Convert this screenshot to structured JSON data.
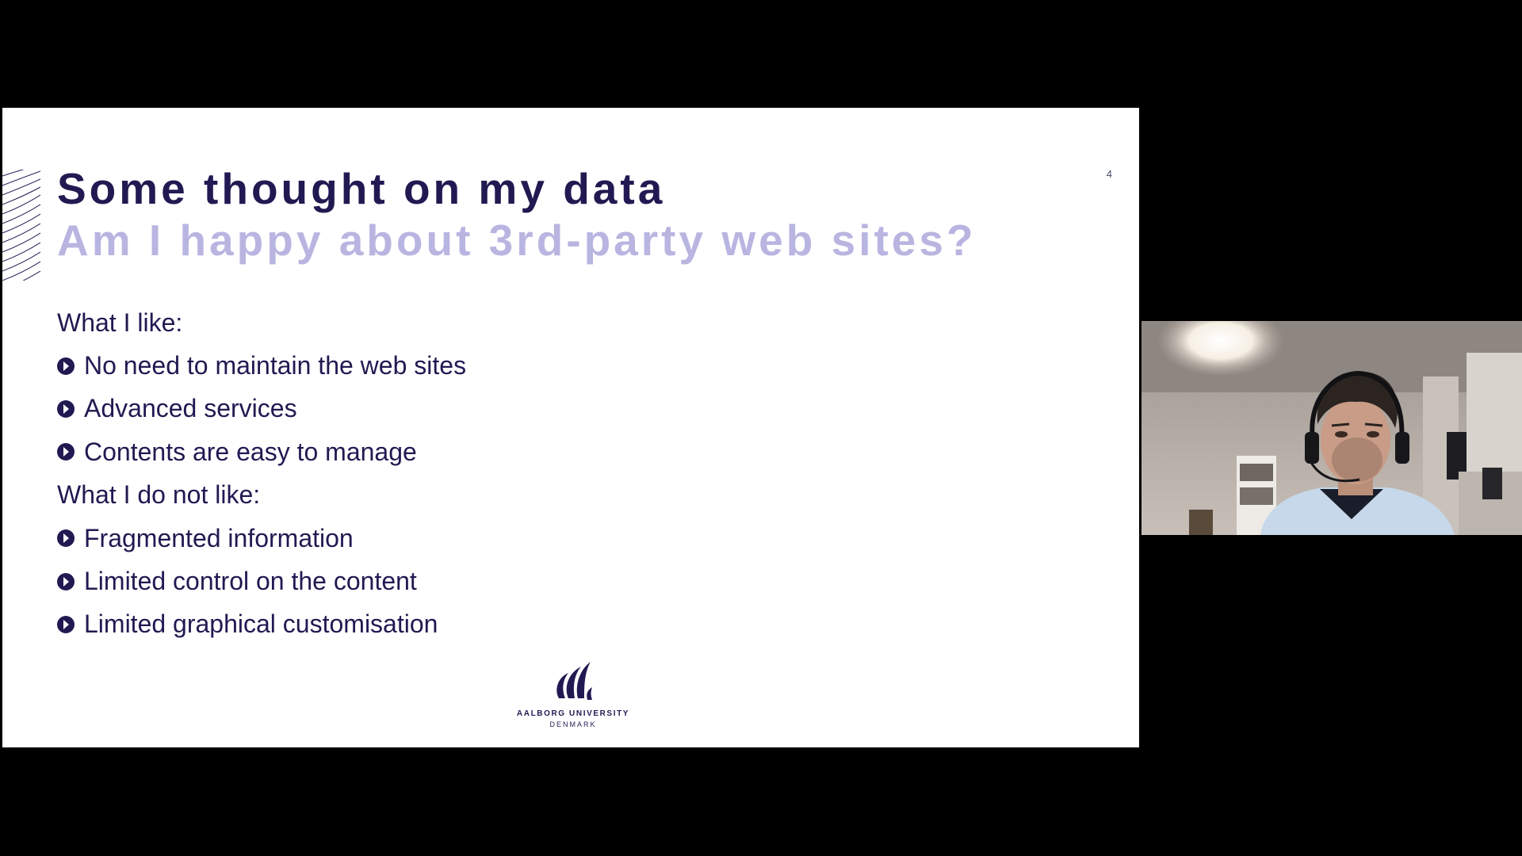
{
  "slide": {
    "number": "4",
    "title": "Some thought on my data",
    "subtitle": "Am I happy about 3rd-party web sites?",
    "sections": [
      {
        "heading": "What I like:",
        "bullets": [
          "No need to maintain the web sites",
          "Advanced services",
          "Contents are easy to manage"
        ]
      },
      {
        "heading": "What I do not like:",
        "bullets": [
          "Fragmented information",
          "Limited control on the content",
          "Limited graphical customisation"
        ]
      }
    ],
    "logo": {
      "name": "AALBORG UNIVERSITY",
      "country": "DENMARK",
      "icon": "aau-logo-icon"
    }
  },
  "colors": {
    "primary": "#211a52",
    "subtitle": "#b9b5e1",
    "background": "#000000"
  }
}
